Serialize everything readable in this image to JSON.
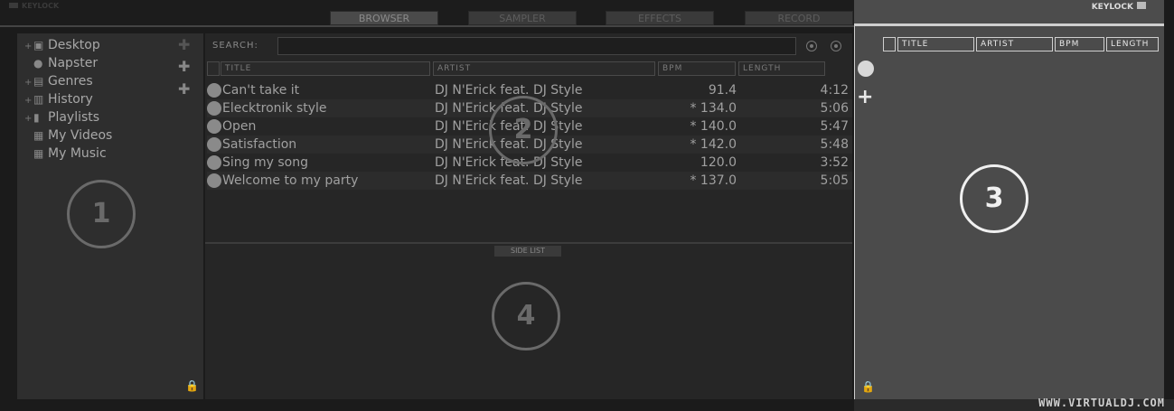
{
  "topbar": {
    "keylock_left": "KEYLOCK",
    "tabs": [
      "BROWSER",
      "SAMPLER",
      "EFFECTS",
      "RECORD"
    ],
    "active_tab": "BROWSER"
  },
  "tree": {
    "items": [
      {
        "label": "Desktop",
        "icon": "desktop-icon",
        "expandable": true
      },
      {
        "label": "Napster",
        "icon": "napster-icon",
        "expandable": false
      },
      {
        "label": "Genres",
        "icon": "genres-icon",
        "expandable": true
      },
      {
        "label": "History",
        "icon": "history-icon",
        "expandable": true
      },
      {
        "label": "Playlists",
        "icon": "playlist-icon",
        "expandable": true
      },
      {
        "label": "My Videos",
        "icon": "folder-videos-icon",
        "expandable": false
      },
      {
        "label": "My Music",
        "icon": "folder-music-icon",
        "expandable": false
      }
    ]
  },
  "browser": {
    "search_label": "SEARCH:",
    "search_value": "",
    "columns": [
      "TITLE",
      "ARTIST",
      "BPM",
      "LENGTH"
    ],
    "rows": [
      {
        "title": "Can't take it",
        "artist": "DJ N'Erick feat. DJ Style",
        "bpm": "91.4",
        "length": "4:12"
      },
      {
        "title": "Elecktronik style",
        "artist": "DJ N'Erick feat. DJ Style",
        "bpm": "* 134.0",
        "length": "5:06"
      },
      {
        "title": "Open",
        "artist": "DJ N'Erick feat. DJ Style",
        "bpm": "* 140.0",
        "length": "5:47"
      },
      {
        "title": "Satisfaction",
        "artist": "DJ N'Erick feat. DJ Style",
        "bpm": "* 142.0",
        "length": "5:48"
      },
      {
        "title": "Sing my song",
        "artist": "DJ N'Erick feat. DJ Style",
        "bpm": "120.0",
        "length": "3:52"
      },
      {
        "title": "Welcome to my party",
        "artist": "DJ N'Erick feat. DJ Style",
        "bpm": "* 137.0",
        "length": "5:05"
      }
    ],
    "side_list_label": "SIDE LIST"
  },
  "right": {
    "keylock_label": "KEYLOCK",
    "columns": [
      "TITLE",
      "ARTIST",
      "BPM",
      "LENGTH"
    ],
    "url": "WWW.VIRTUALDJ.COM"
  },
  "callouts": [
    "1",
    "2",
    "3",
    "4"
  ]
}
